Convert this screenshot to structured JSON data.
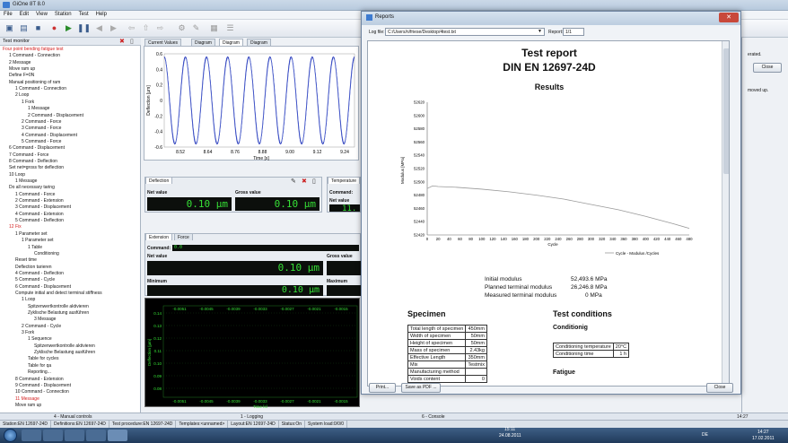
{
  "app": {
    "title": "GiOne 8T 8.0"
  },
  "menu": [
    "File",
    "Edit",
    "View",
    "Station",
    "Test",
    "Help"
  ],
  "tree": {
    "header": "Test monitor",
    "items": [
      {
        "text": "Four point bending fatigue test",
        "indent": 0,
        "red": true
      },
      {
        "text": "1 Command - Connection",
        "indent": 1
      },
      {
        "text": "2 Message",
        "indent": 1
      },
      {
        "text": "Move ram up",
        "indent": 1
      },
      {
        "text": "Define F=0N",
        "indent": 1
      },
      {
        "text": "Manual positioning of ram",
        "indent": 1
      },
      {
        "text": "1 Command - Connection",
        "indent": 2
      },
      {
        "text": "2 Loop",
        "indent": 2
      },
      {
        "text": "1 Fork",
        "indent": 3
      },
      {
        "text": "1 Message",
        "indent": 4
      },
      {
        "text": "2 Command - Displacement",
        "indent": 4
      },
      {
        "text": "2 Command - Force",
        "indent": 3
      },
      {
        "text": "3 Command - Force",
        "indent": 3
      },
      {
        "text": "4 Command - Displacement",
        "indent": 3
      },
      {
        "text": "5 Command - Force",
        "indent": 3
      },
      {
        "text": "6 Command - Displacement",
        "indent": 1
      },
      {
        "text": "7 Command - Force",
        "indent": 1
      },
      {
        "text": "8 Command - Deflection",
        "indent": 1
      },
      {
        "text": "Set net=gross for deflection",
        "indent": 1
      },
      {
        "text": "10 Loop",
        "indent": 1
      },
      {
        "text": "1 Message",
        "indent": 2
      },
      {
        "text": "Do all necessary taring",
        "indent": 1
      },
      {
        "text": "1 Command - Force",
        "indent": 2
      },
      {
        "text": "2 Command - Extension",
        "indent": 2
      },
      {
        "text": "3 Command - Displacement",
        "indent": 2
      },
      {
        "text": "4 Command - Extension",
        "indent": 2
      },
      {
        "text": "5 Command - Deflection",
        "indent": 2
      },
      {
        "text": "12 Fix",
        "indent": 1,
        "red": true
      },
      {
        "text": "1 Parameter set",
        "indent": 2
      },
      {
        "text": "1 Parameter set",
        "indent": 3
      },
      {
        "text": "1 Table",
        "indent": 4
      },
      {
        "text": "Conditioning",
        "indent": 5
      },
      {
        "text": "Reset time",
        "indent": 2
      },
      {
        "text": "Deflection tarieren",
        "indent": 2
      },
      {
        "text": "4 Command - Deflection",
        "indent": 2
      },
      {
        "text": "5 Command - Cycle",
        "indent": 2
      },
      {
        "text": "6 Command - Displacement",
        "indent": 2
      },
      {
        "text": "Compute initial and detect terminal stiffness",
        "indent": 2
      },
      {
        "text": "1 Loop",
        "indent": 3
      },
      {
        "text": "Spitzenwertkontrolle aktivieren",
        "indent": 4
      },
      {
        "text": "Zyklische Belastung ausführen",
        "indent": 4
      },
      {
        "text": "3 Message",
        "indent": 5
      },
      {
        "text": "2 Command - Cycle",
        "indent": 3
      },
      {
        "text": "3 Fork",
        "indent": 3
      },
      {
        "text": "1 Sequence",
        "indent": 4
      },
      {
        "text": "Spitzenwertkontrolle aktivieren",
        "indent": 5
      },
      {
        "text": "Zyklische Belastung ausführen",
        "indent": 5
      },
      {
        "text": "Table for cycles",
        "indent": 4
      },
      {
        "text": "Table for qa",
        "indent": 4
      },
      {
        "text": "Reporting...",
        "indent": 4
      },
      {
        "text": "8 Command - Extension",
        "indent": 2
      },
      {
        "text": "9 Command - Displacement",
        "indent": 2
      },
      {
        "text": "10 Command - Connection",
        "indent": 2
      },
      {
        "text": "11 Message",
        "indent": 2,
        "red": true
      },
      {
        "text": "Move ram up",
        "indent": 2
      }
    ]
  },
  "center": {
    "tabs": [
      "Current Values",
      "Diagram",
      "Diagram",
      "Diagram"
    ],
    "active_tab": 2,
    "chart_top": {
      "ylabel": "Deflection [µm]",
      "xlabel": "Time [s]",
      "xticks": [
        "8.52",
        "8.64",
        "8.76",
        "8.88",
        "9.00",
        "9.12",
        "9.24"
      ],
      "yticks": [
        "0.6",
        "0.4",
        "0.2",
        "0",
        "-0.2",
        "-0.4",
        "-0.6"
      ]
    },
    "deflection": {
      "title": "Deflection",
      "net_label": "Net value",
      "gross_label": "Gross value",
      "net": "0.10 µm",
      "gross": "0.10 µm"
    },
    "temperature": {
      "title": "Temperature",
      "command_label": "Command:",
      "net_label": "Net value",
      "net": "11."
    },
    "extension": {
      "tabs": [
        "Extension",
        "Force"
      ],
      "command_label": "Command:",
      "command_value": "0.0",
      "net_label": "Net value",
      "gross_label": "Gross value",
      "net": "0.10 µm",
      "minimum_label": "Minimum",
      "maximum_label": "Maximum",
      "minimum": "0.10 µm"
    },
    "scope": {
      "ylabel": "Deflection [µm]",
      "xlabel": "Time [s]",
      "yticks": [
        "0.14",
        "0.13",
        "0.12",
        "0.11",
        "0.10",
        "0.09",
        "0.08"
      ],
      "xticks": [
        "-0.0051",
        "-0.0045",
        "-0.0039",
        "-0.0033",
        "-0.0027",
        "-0.0021",
        "-0.0015"
      ]
    }
  },
  "bottom": {
    "strips": [
      "4 - Manual controls",
      "1 - Logging",
      "6 - Console"
    ],
    "status": [
      "Station:EN 12697-24D",
      "Definitions:EN 12697-24D",
      "Test procedure:EN 12697-24D",
      "Templates:<unnamed>",
      "Layout:EN 12697-24D",
      "Status:On",
      "System load:0/0/0"
    ],
    "tray_time": "14:27",
    "tray_date": "17.02.2011",
    "taskbar_time": "15:11",
    "taskbar_date": "24.08.2011",
    "lang": "DE"
  },
  "rightbg": {
    "text1": "erated.",
    "close": "Close",
    "text2": "moved up."
  },
  "dialog": {
    "caption": "Reports",
    "logfile_label": "Log file:",
    "logfile_value": "C:/Users/n/friese/Desktop/4test.txt",
    "report_label": "Report:",
    "report_value": "1/1",
    "doc": {
      "title": "Test report",
      "subtitle": "DIN EN 12697-24D",
      "results": "Results",
      "legend": "Cycle - Modulus /Cycles",
      "ylabel": "Modulus [MPa]",
      "xlabel": "Cycle",
      "yticks": [
        "52620",
        "52600",
        "52580",
        "52560",
        "52540",
        "52520",
        "52500",
        "52480",
        "52460",
        "52440",
        "52420"
      ],
      "xticks": [
        "0",
        "10",
        "20",
        "30",
        "40",
        "50",
        "60",
        "70",
        "80",
        "90",
        "100",
        "110",
        "120",
        "130",
        "140",
        "150",
        "160",
        "170",
        "180",
        "190",
        "200",
        "210",
        "220",
        "230",
        "240",
        "250",
        "260",
        "270",
        "280",
        "290",
        "300",
        "310",
        "320",
        "330",
        "340",
        "350",
        "360",
        "370",
        "380",
        "390",
        "400",
        "410",
        "420",
        "430",
        "440",
        "450",
        "460",
        "470",
        "480"
      ],
      "metrics": [
        {
          "label": "Initial modulus",
          "value": "52,493.6 MPa"
        },
        {
          "label": "Planned terminal modulus",
          "value": "26,246.8 MPa"
        },
        {
          "label": "Measured terminal modulus",
          "value": "0 MPa"
        }
      ],
      "specimen_title": "Specimen",
      "specimen": [
        [
          "Total length of specimen",
          "450mm"
        ],
        [
          "Width of specimen",
          "50mm"
        ],
        [
          "Height of specimen",
          "50mm"
        ],
        [
          "Mass of specimen",
          "2.43kg"
        ],
        [
          "Effective Length",
          "350mm"
        ],
        [
          "Mix",
          "Testmix"
        ],
        [
          "Manufacturing method",
          ""
        ],
        [
          "Voids content",
          "0"
        ]
      ],
      "conditions_title": "Test conditions",
      "conditioning_title": "Conditionig",
      "conditioning": [
        [
          "Conditioning temperature",
          "20°C"
        ],
        [
          "Conditioning time",
          "1 h"
        ]
      ],
      "fatigue_title": "Fatigue"
    },
    "print_label": "Print...",
    "save_pdf_label": "Save as PDF ...",
    "close_label": "Close"
  },
  "chart_data": [
    {
      "type": "line",
      "title": "",
      "xlabel": "Time [s]",
      "ylabel": "Deflection [µm]",
      "xlim": [
        8.46,
        9.3
      ],
      "ylim": [
        -0.6,
        0.6
      ],
      "series": [
        {
          "x_start": 8.46,
          "x_end": 9.3,
          "cycles": 9,
          "amplitude": 0.56
        }
      ]
    },
    {
      "type": "line",
      "title": "",
      "xlabel": "Cycle",
      "ylabel": "Modulus [MPa]",
      "xlim": [
        0,
        480
      ],
      "ylim": [
        52420,
        52620
      ],
      "series": [
        {
          "name": "Cycle - Modulus /Cycles",
          "x": [
            0,
            10,
            20,
            50,
            100,
            150,
            200,
            250,
            300,
            350,
            400,
            450,
            480
          ],
          "y": [
            52490,
            52494,
            52493,
            52492,
            52489,
            52485,
            52480,
            52474,
            52466,
            52458,
            52448,
            52437,
            52430
          ]
        }
      ]
    }
  ]
}
